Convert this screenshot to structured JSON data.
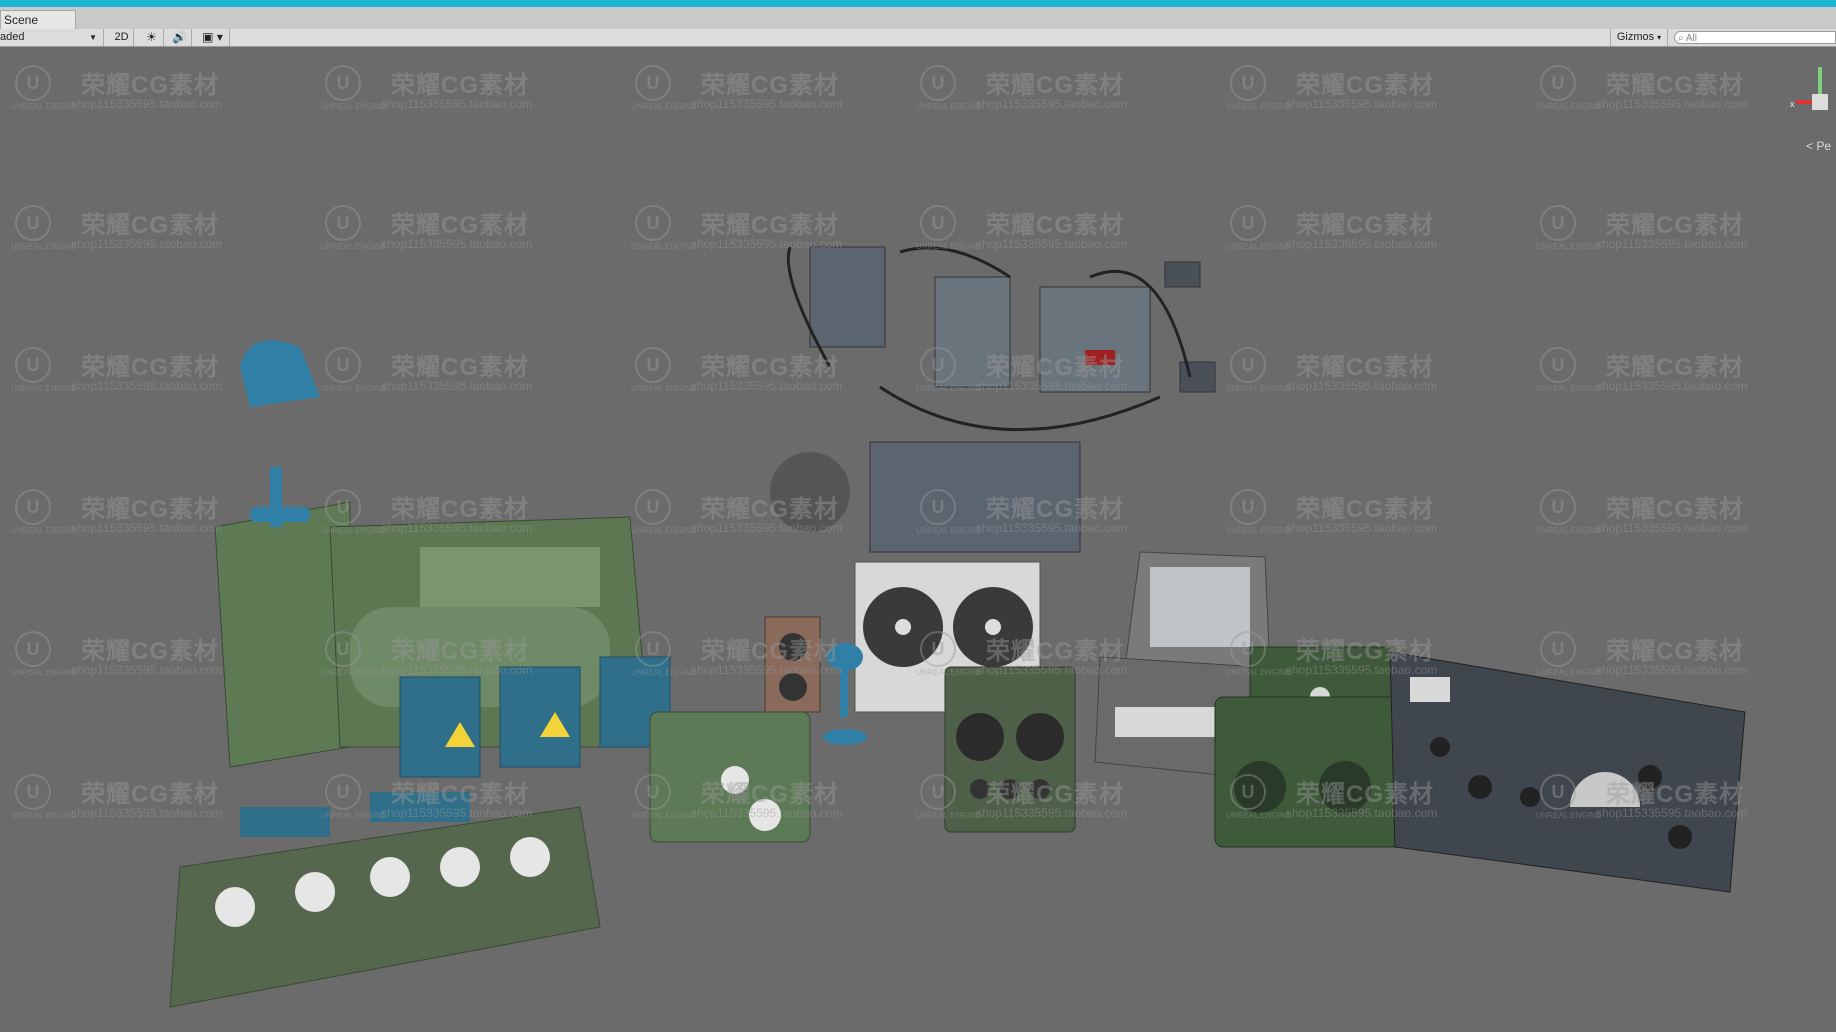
{
  "window": {
    "tab_title": "Scene"
  },
  "toolbar": {
    "shading_mode": "aded",
    "mode_2d": "2D",
    "gizmos_label": "Gizmos",
    "search_placeholder": "All"
  },
  "scene": {
    "persp_label": "< Pe",
    "watermark": {
      "cn": "荣耀CG素材",
      "url": "shop115335595.taobao.com",
      "brand": "UNREAL ENGINE"
    }
  }
}
